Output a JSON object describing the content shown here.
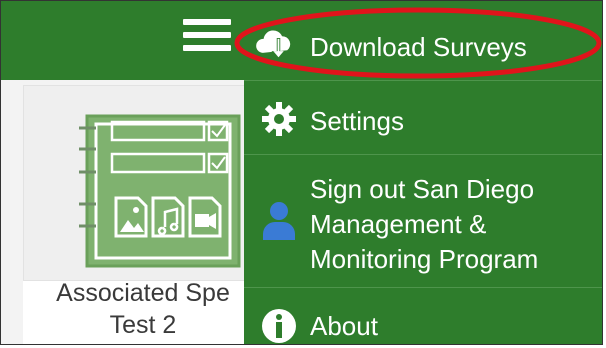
{
  "header": {
    "menu_button": "hamburger-menu"
  },
  "survey_card": {
    "title_line1": "Associated Spe",
    "title_line2": "Test 2"
  },
  "side_menu": {
    "items": [
      {
        "label": "Download Surveys",
        "icon": "cloud-download-icon"
      },
      {
        "label": "Settings",
        "icon": "gear-icon"
      },
      {
        "label_lines": [
          "Sign out San Diego",
          "Management &",
          "Monitoring Program"
        ],
        "icon": "user-icon"
      },
      {
        "label": "About",
        "icon": "info-icon"
      }
    ]
  },
  "colors": {
    "header_green": "#2e7d2c",
    "annotation_red": "#e0141b",
    "survey_icon_green": "#7fb26f"
  }
}
